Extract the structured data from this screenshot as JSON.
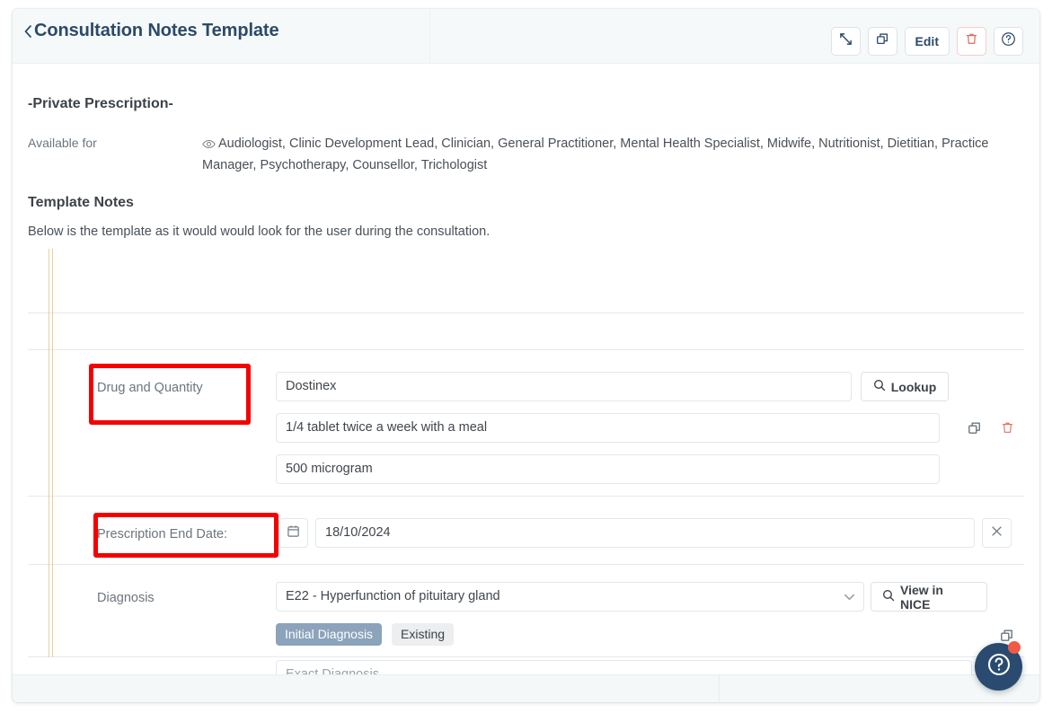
{
  "header": {
    "back_icon": "chevron-left-icon",
    "title": "Consultation Notes Template",
    "buttons": [
      {
        "name": "expand-button",
        "icon": "expand-arrows-icon",
        "label": ""
      },
      {
        "name": "duplicate-button",
        "icon": "copy-icon",
        "label": ""
      },
      {
        "name": "edit-button",
        "icon": "",
        "label": "Edit"
      },
      {
        "name": "delete-button",
        "icon": "trash-icon",
        "label": ""
      },
      {
        "name": "help-button",
        "icon": "question-circle-icon",
        "label": ""
      }
    ]
  },
  "body": {
    "private_prescription_title": "-Private Prescription-",
    "available_for_label": "Available for",
    "available_for_icon": "eye-icon",
    "available_for_roles": "Audiologist,  Clinic Development Lead,  Clinician,  General Practitioner,  Mental Health Specialist,  Midwife,  Nutritionist, Dietitian,  Practice Manager,  Psychotherapy, Counsellor,  Trichologist",
    "template_notes_title": "Template Notes",
    "template_notes_desc": "Below is the template as it would would look for the user during the consultation."
  },
  "form": {
    "drug": {
      "label": "Drug and Quantity",
      "name_value": "Dostinex",
      "dose_value": "1/4 tablet twice a week with a meal",
      "strength_value": "500 microgram",
      "lookup_label": "Lookup",
      "lookup_icon": "search-icon",
      "duplicate_icon": "copy-icon",
      "delete_icon": "trash-icon"
    },
    "end_date": {
      "label": "Prescription End Date:",
      "calendar_icon": "calendar-icon",
      "value": "18/10/2024",
      "clear_icon": "close-x-icon"
    },
    "diagnosis": {
      "label": "Diagnosis",
      "select_value": "E22 - Hyperfunction of pituitary gland",
      "chevron_icon": "chevron-down-icon",
      "nice_label": "View in NICE",
      "nice_icon": "search-icon",
      "pill_initial": "Initial Diagnosis",
      "pill_existing": "Existing",
      "duplicate_icon": "copy-icon",
      "exact_placeholder": "Exact Diagnosis",
      "exact_value": ""
    }
  },
  "fab": {
    "icon": "question-circle-icon",
    "has_notification": true
  },
  "colors": {
    "title_blue": "#2b4a69",
    "annotation_red": "#f50000",
    "danger": "#e06a5c",
    "pill_active": "#8ba3bb",
    "rail_gold": "#e4c98f",
    "fab_blue": "#2a4a70",
    "fab_dot": "#ef5a46"
  }
}
